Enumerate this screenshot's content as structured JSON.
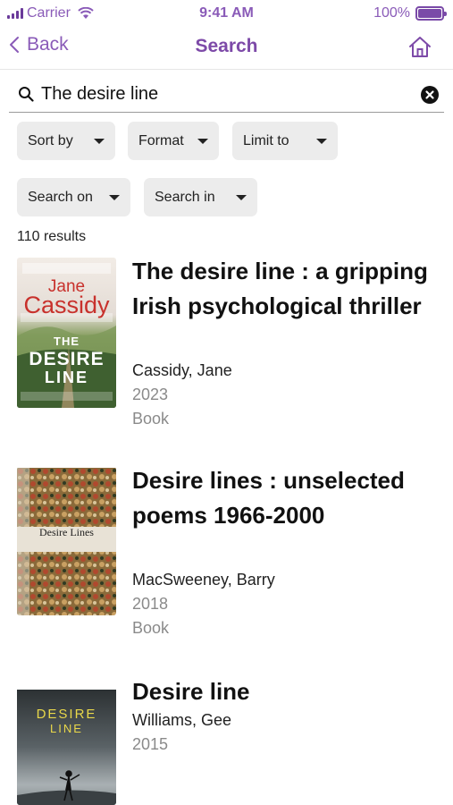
{
  "status_bar": {
    "carrier": "Carrier",
    "time": "9:41 AM",
    "battery": "100%",
    "icons": [
      "signal-icon",
      "wifi-icon",
      "battery-icon"
    ]
  },
  "nav": {
    "back_label": "Back",
    "title": "Search",
    "icons": [
      "chevron-left-icon",
      "home-icon"
    ]
  },
  "search": {
    "value": "The desire line",
    "icons": [
      "search-icon",
      "clear-icon"
    ]
  },
  "filters": {
    "sort_by": "Sort by",
    "format": "Format",
    "limit_to": "Limit to",
    "search_on": "Search on",
    "search_in": "Search in"
  },
  "results_count": "110 results",
  "results": [
    {
      "title": "The desire line : a gripping Irish psychological thriller",
      "author": "Cassidy, Jane",
      "year": "2023",
      "format": "Book",
      "cover": {
        "author_first": "Jane",
        "author_last": "Cassidy",
        "title_line1": "THE",
        "title_line2": "DESIRE",
        "title_line3": "LINE"
      }
    },
    {
      "title": "Desire lines : unselected poems 1966-2000",
      "author": "MacSweeney, Barry",
      "year": "2018",
      "format": "Book",
      "cover": {
        "title": "Desire Lines"
      }
    },
    {
      "title": "Desire line",
      "author": "Williams, Gee",
      "year": "2015",
      "format": "",
      "cover": {
        "title_line1": "DESIRE",
        "title_line2": "LINE"
      }
    }
  ],
  "colors": {
    "accent": "#7d4aa8",
    "chip_bg": "#ececec",
    "muted_text": "#8a8a8a"
  }
}
